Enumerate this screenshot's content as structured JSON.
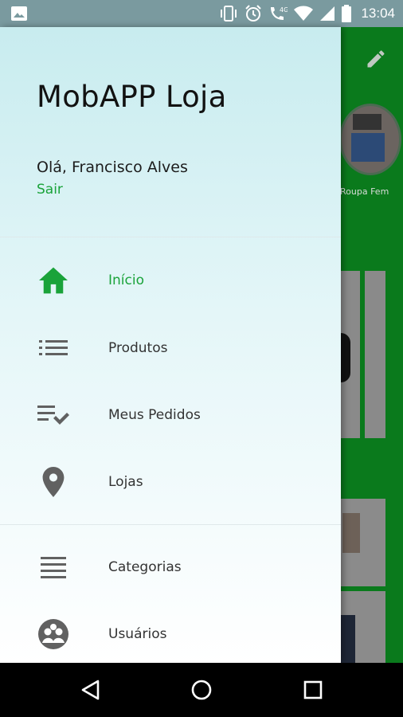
{
  "status_bar": {
    "time": "13:04",
    "icons": [
      "image-icon",
      "vibrate-icon",
      "alarm-icon",
      "call-4g-icon",
      "wifi-icon",
      "cell-signal-icon",
      "battery-icon"
    ]
  },
  "background_app": {
    "category_label": "Roupa Fem",
    "accent": "#0a7a1c"
  },
  "drawer": {
    "title": "MobAPP Loja",
    "greeting": "Olá, Francisco Alves",
    "logout_label": "Sair",
    "accent": "#1aa33a",
    "items": [
      {
        "label": "Início",
        "icon": "home-icon",
        "active": true
      },
      {
        "label": "Produtos",
        "icon": "list-icon",
        "active": false
      },
      {
        "label": "Meus Pedidos",
        "icon": "playlist-check-icon",
        "active": false
      },
      {
        "label": "Lojas",
        "icon": "location-pin-icon",
        "active": false
      },
      {
        "label": "Categorias",
        "icon": "menu-lines-icon",
        "active": false
      },
      {
        "label": "Usuários",
        "icon": "users-group-icon",
        "active": false
      }
    ]
  },
  "nav_bar": {
    "buttons": [
      "back-icon",
      "home-circle-icon",
      "recents-icon"
    ]
  }
}
